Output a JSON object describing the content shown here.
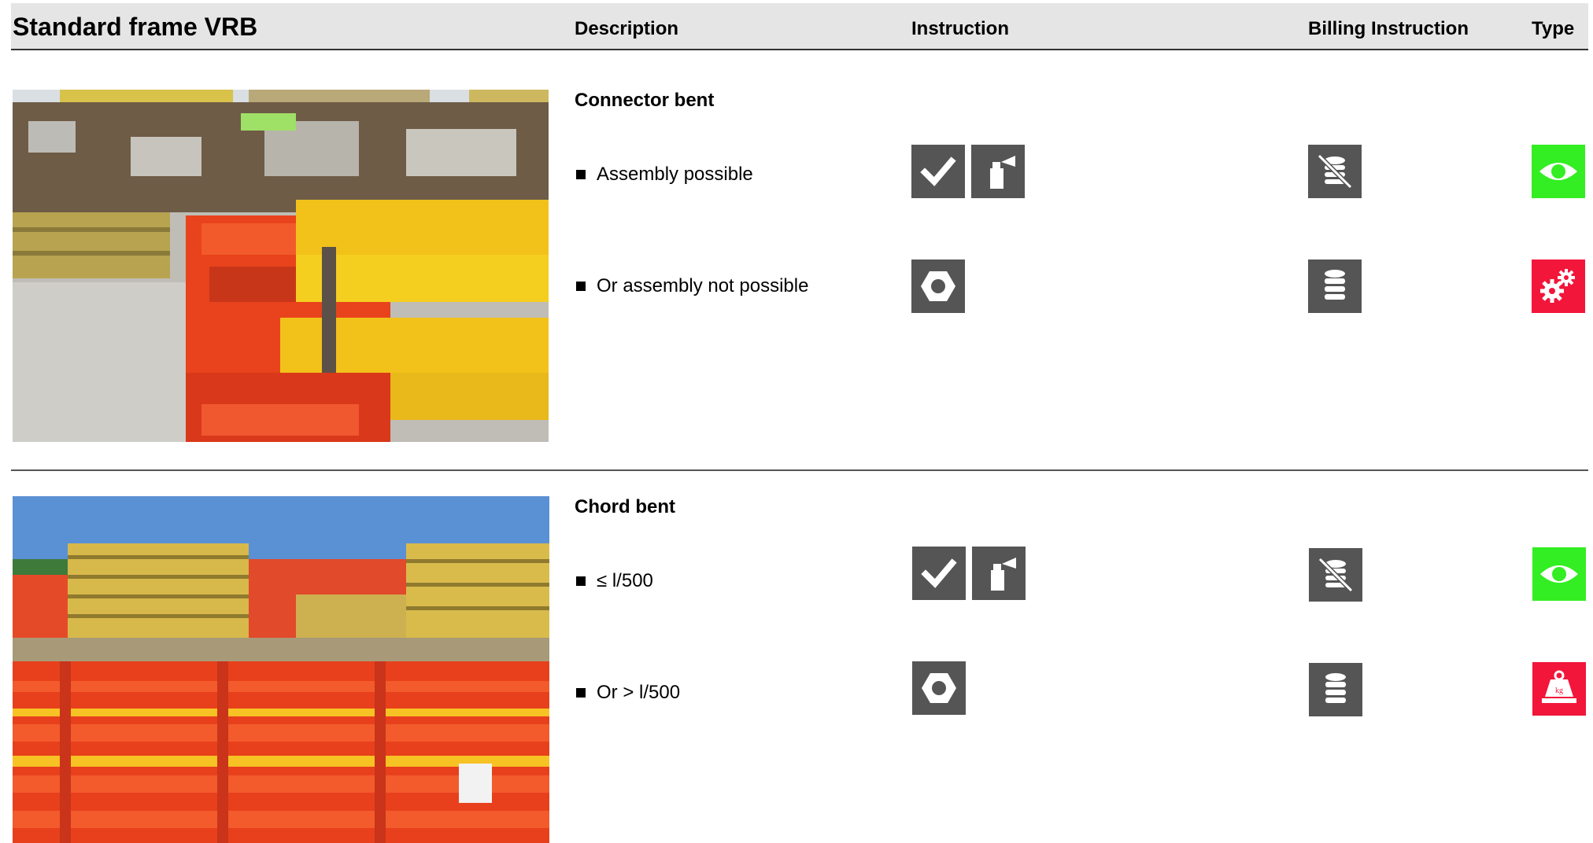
{
  "header": {
    "title": "Standard frame VRB",
    "col_description": "Description",
    "col_instruction": "Instruction",
    "col_billing": "Billing Instruction",
    "col_type": "Type"
  },
  "sections": [
    {
      "title": "Connector bent",
      "rows": [
        {
          "text": "Assembly possible",
          "instruction_icons": [
            "check-icon",
            "spray-can-icon"
          ],
          "billing_icon": "no-billing-coins-icon",
          "type_icon": "eye-icon",
          "type_color": "#33ee22"
        },
        {
          "text": "Or assembly not possible",
          "instruction_icons": [
            "nut-icon"
          ],
          "billing_icon": "coins-icon",
          "type_icon": "gears-icon",
          "type_color": "#f2163a"
        }
      ]
    },
    {
      "title": "Chord bent",
      "rows": [
        {
          "text": "≤ l/500",
          "instruction_icons": [
            "check-icon",
            "spray-can-icon"
          ],
          "billing_icon": "no-billing-coins-icon",
          "type_icon": "eye-icon",
          "type_color": "#33ee22"
        },
        {
          "text": "Or > l/500",
          "instruction_icons": [
            "nut-icon"
          ],
          "billing_icon": "coins-icon",
          "type_icon": "scrap-weight-icon",
          "type_color": "#f2163a"
        }
      ]
    }
  ],
  "colors": {
    "header_bg": "#e5e5e5",
    "icon_bg": "#555555",
    "type_green": "#33ee22",
    "type_red": "#f2163a"
  }
}
